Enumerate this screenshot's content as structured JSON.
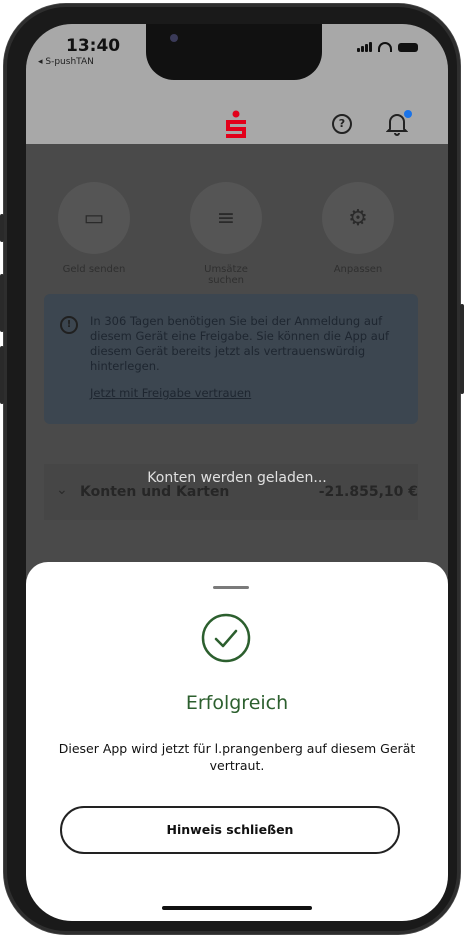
{
  "status_bar": {
    "time": "13:40",
    "back_app": "◂ S-pushTAN",
    "icons": [
      "signal-icon",
      "wifi-icon",
      "battery-icon"
    ]
  },
  "header": {
    "logo": "sparkasse-logo",
    "help_glyph": "?",
    "icons": [
      "help-icon",
      "bell-icon"
    ],
    "notification_dot_color": "#1a73e8"
  },
  "quick_actions": [
    {
      "label": "Geld senden",
      "icon": "card-send-icon"
    },
    {
      "label": "Umsätze suchen",
      "icon": "list-search-icon"
    },
    {
      "label": "Anpassen",
      "icon": "gear-icon"
    }
  ],
  "info_box": {
    "text": "In 306 Tagen benötigen Sie bei der Anmeldung auf diesem Gerät eine Freigabe. Sie können die App auf diesem Gerät bereits jetzt als vertrauenswürdig hinterlegen.",
    "link": "Jetzt mit Freigabe vertrauen"
  },
  "accounts": {
    "label": "Konten und Karten",
    "amount": "-21.855,10 €"
  },
  "loading_text": "Konten werden geladen...",
  "sheet": {
    "title": "Erfolgreich",
    "body": "Dieser App wird jetzt für l.prangenberg auf diesem Gerät vertraut.",
    "button": "Hinweis schließen",
    "accent_color": "#2c5f2e"
  }
}
